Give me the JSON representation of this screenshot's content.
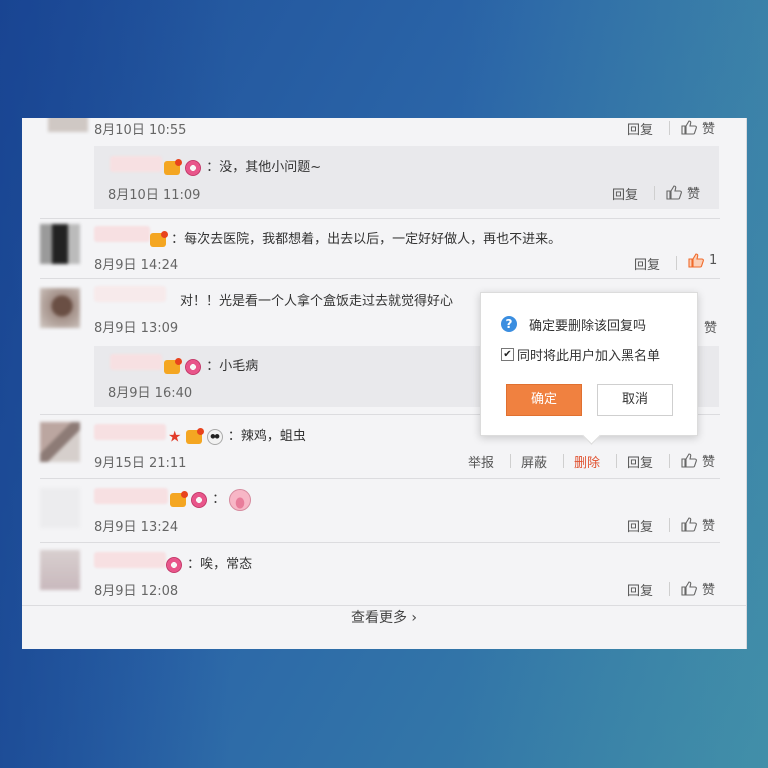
{
  "colors": {
    "accent": "#f08140",
    "delete_red": "#e0512f",
    "like_active": "#f06a2a"
  },
  "actions": {
    "reply": "回复",
    "like": "赞",
    "report": "举报",
    "block": "屏蔽",
    "delete": "删除"
  },
  "comments": [
    {
      "time": "8月10日 10:55"
    },
    {
      "text": "：没，其他小问题~",
      "time": "8月10日 11:09"
    },
    {
      "text": "：每次去医院，我都想着，出去以后，一定好好做人，再也不进来。",
      "time": "8月9日 14:24",
      "likes": "1"
    },
    {
      "text": "对！！光是看一个人拿个盒饭走过去就觉得好心",
      "time": "8月9日 13:09"
    },
    {
      "text": "：小毛病",
      "time": "8月9日 16:40"
    },
    {
      "text": "：辣鸡，蛆虫",
      "time": "9月15日 21:11"
    },
    {
      "text": "：",
      "time": "8月9日 13:24"
    },
    {
      "text": "：唉，常态",
      "time": "8月9日 12:08"
    }
  ],
  "popup": {
    "question": "确定要删除该回复吗",
    "checkbox_label": "同时将此用户加入黑名单",
    "checked": true,
    "confirm": "确定",
    "cancel": "取消"
  },
  "load_more": "查看更多 ›"
}
